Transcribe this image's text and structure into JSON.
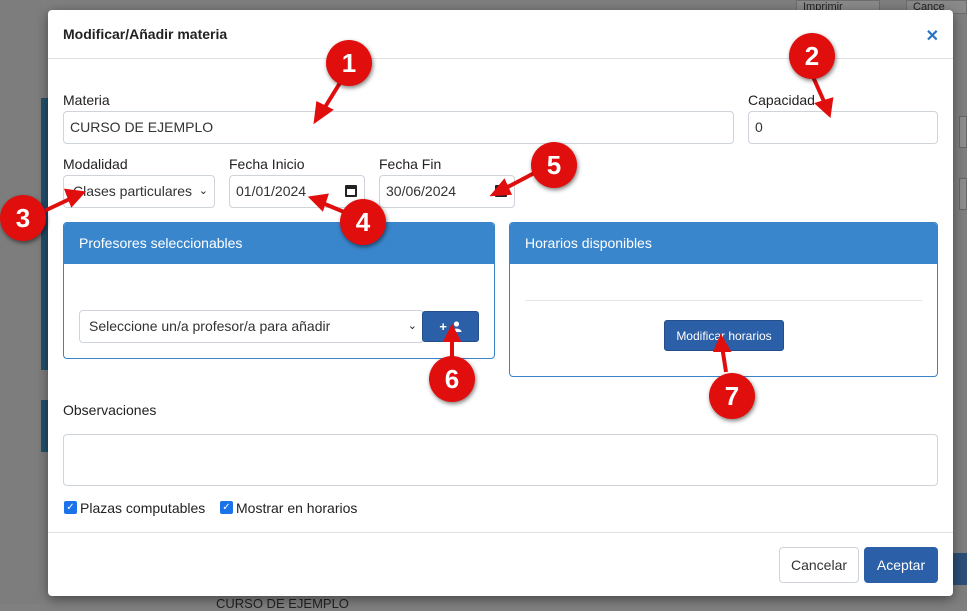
{
  "background": {
    "top_buttons": [
      "Imprimir",
      "Cance"
    ],
    "bottom_text": "CURSO DE EJEMPLO",
    "right_button_label": "d"
  },
  "modal": {
    "title": "Modificar/Añadir materia",
    "close_icon": "close-icon",
    "materia": {
      "label": "Materia",
      "value": "CURSO DE EJEMPLO"
    },
    "capacidad": {
      "label": "Capacidad",
      "value": "0"
    },
    "modalidad": {
      "label": "Modalidad",
      "value": "Clases particulares"
    },
    "fecha_inicio": {
      "label": "Fecha Inicio",
      "value": "01/01/2024"
    },
    "fecha_fin": {
      "label": "Fecha Fin",
      "value": "30/06/2024"
    },
    "profesores": {
      "title": "Profesores seleccionables",
      "select_value": "Seleccione un/a profesor/a para añadir",
      "add_button_icon": "add-user-icon"
    },
    "horarios": {
      "title": "Horarios disponibles",
      "button_label": "Modificar horarios"
    },
    "observaciones": {
      "label": "Observaciones",
      "value": ""
    },
    "checkboxes": [
      {
        "label": "Plazas computables",
        "checked": true
      },
      {
        "label": "Mostrar en horarios",
        "checked": true
      }
    ],
    "buttons": {
      "cancel": "Cancelar",
      "accept": "Aceptar"
    }
  },
  "markers": [
    "1",
    "2",
    "3",
    "4",
    "5",
    "6",
    "7"
  ],
  "colors": {
    "accent": "#2b5fa7",
    "panel_header": "#3a86cc",
    "marker": "#e10e0e"
  }
}
